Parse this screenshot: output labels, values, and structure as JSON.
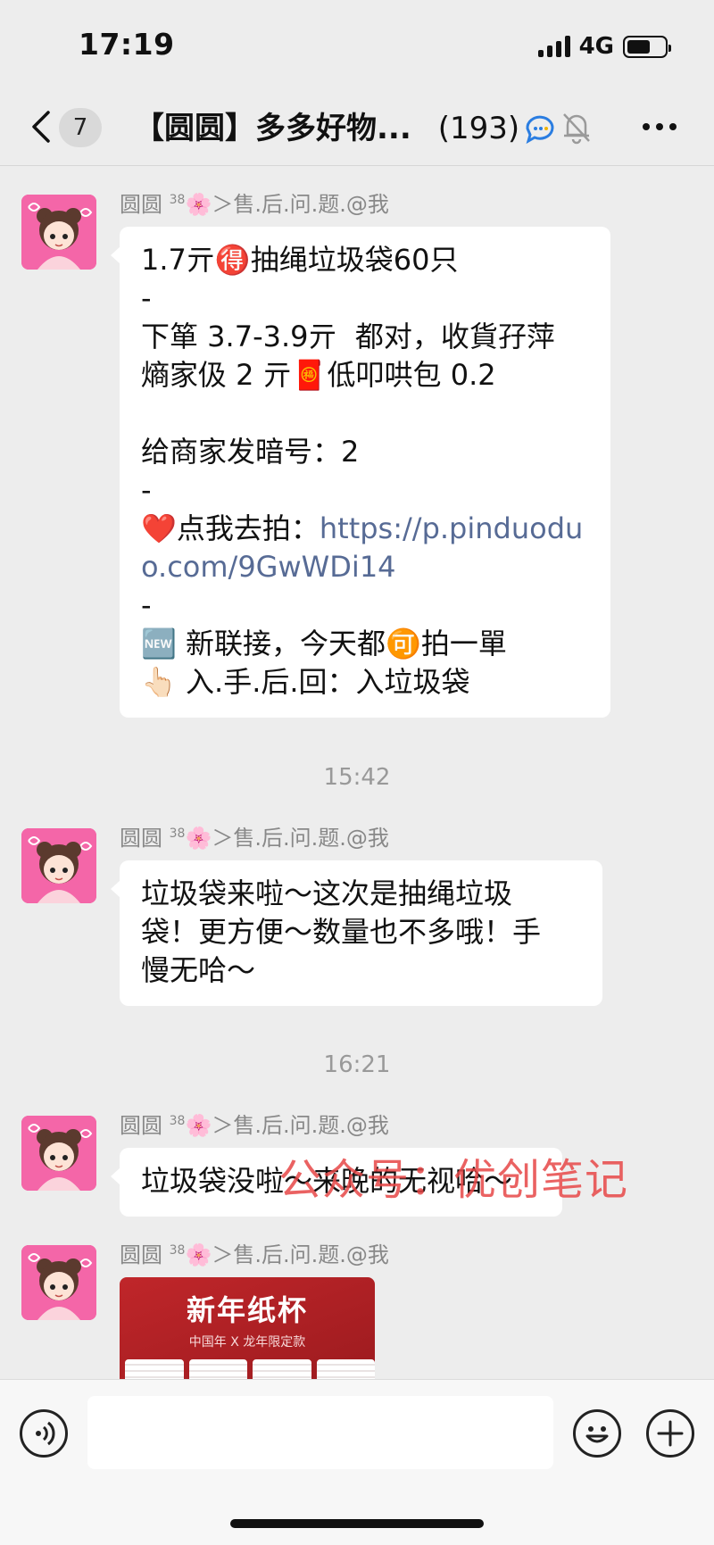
{
  "status_bar": {
    "time": "17:19",
    "network": "4G",
    "battery_level": 0.62
  },
  "header": {
    "back_count": "7",
    "title": "【圆圆】多多好物...",
    "member_count": "(193)",
    "icons": [
      "chevron-left-icon",
      "chat-tag-icon",
      "mute-bell-icon",
      "more-icon"
    ]
  },
  "messages": [
    {
      "sender": "圆圆",
      "sender_sup": "38",
      "sender_suffix": "🌸＞售.后.问.题.@我",
      "lines": [
        "1.7亓🉐抽绳垃圾袋60只",
        "-",
        "下箪 3.7-3.9亓  都对，收貨孖萍",
        "熵家伋 2 亓🧧低叩哄包 0.2",
        "",
        "给商家发暗号：2",
        "-",
        "❤️点我去拍：https://p.pinduodu",
        "o.com/9GwWDi14",
        "-",
        "🆕 新联接，今天都🉑拍一單",
        "👆🏻 入.手.后.回：入垃圾袋"
      ]
    },
    {
      "timestamp": "15:42",
      "sender": "圆圆",
      "sender_sup": "38",
      "sender_suffix": "🌸＞售.后.问.题.@我",
      "lines": [
        "垃圾袋来啦～这次是抽绳垃圾",
        "袋！更方便～数量也不多哦！手",
        "慢无哈～"
      ]
    },
    {
      "timestamp": "16:21",
      "sender": "圆圆",
      "sender_sup": "38",
      "sender_suffix": "🌸＞售.后.问.题.@我",
      "lines": [
        "垃圾袋没啦～来晚的无视哈～"
      ]
    },
    {
      "sender": "圆圆",
      "sender_sup": "38",
      "sender_suffix": "🌸＞售.后.问.题.@我",
      "image": {
        "title": "新年纸杯",
        "subtitle": "中国年 X 龙年限定款"
      }
    }
  ],
  "watermark": "公众号：优创笔记",
  "input_bar": {
    "placeholder": "",
    "icons": [
      "voice-icon",
      "emoji-icon",
      "plus-icon"
    ]
  }
}
